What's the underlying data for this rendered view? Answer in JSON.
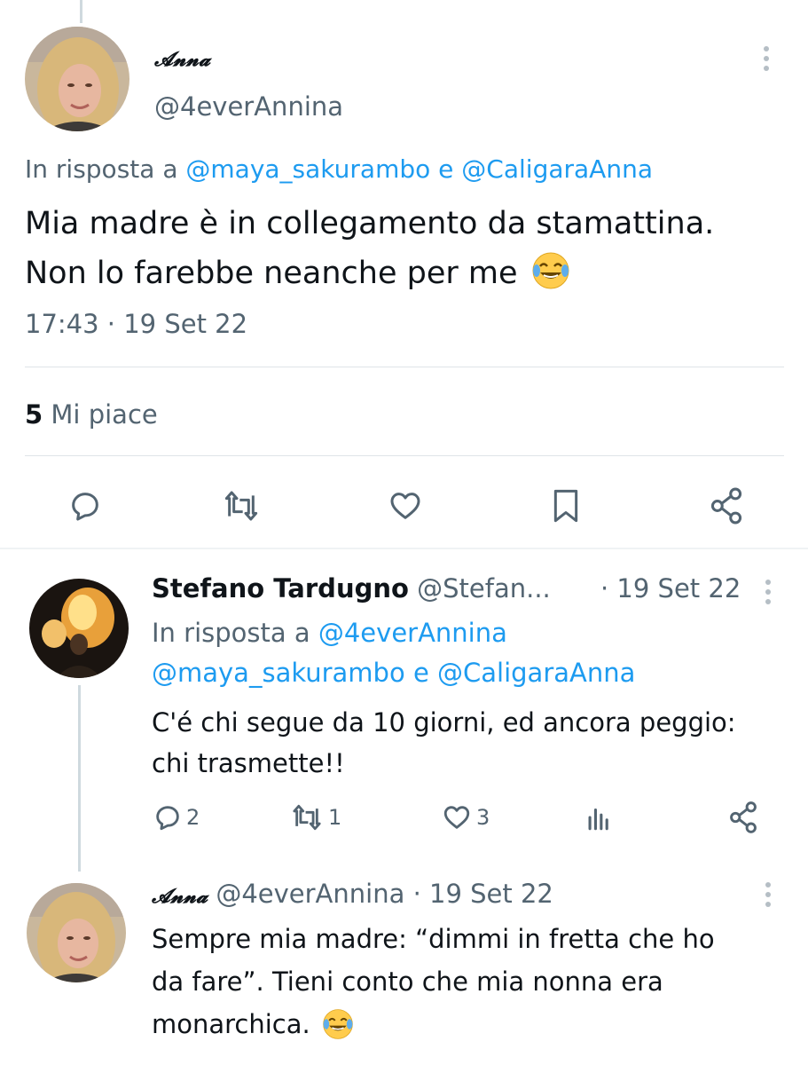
{
  "main_tweet": {
    "display_name": "𝓐𝓷𝓷𝓪",
    "handle": "@4everAnnina",
    "reply_prefix": "In risposta a",
    "reply_user_1": "@maya_sakurambo",
    "reply_conjunction": "e",
    "reply_user_2": "@CaligaraAnna",
    "text_line_1": "Mia madre è in collegamento da stamattina.",
    "text_line_2": "Non lo farebbe neanche per me",
    "emoji": "😂",
    "timestamp": "17:43 · 19 Set 22",
    "likes_count": "5",
    "likes_label": "Mi piace",
    "actions": [
      "reply-icon",
      "retweet-icon",
      "like-icon",
      "bookmark-icon",
      "share-icon"
    ]
  },
  "reply_1": {
    "display_name": "Stefano Tardugno",
    "handle": "@Stefan...",
    "date": "· 19 Set 22",
    "reply_prefix": "In risposta a",
    "reply_user_1": "@4everAnnina",
    "reply_user_2": "@maya_sakurambo",
    "reply_conjunction": "e",
    "reply_user_3": "@CaligaraAnna",
    "text_line_1": "C'é chi segue da 10 giorni, ed ancora peggio:",
    "text_line_2": "chi trasmette!!",
    "replies": "2",
    "retweets": "1",
    "likes": "3"
  },
  "reply_2": {
    "display_name": "𝓐𝓷𝓷𝓪",
    "handle": "@4everAnnina",
    "date": "· 19 Set 22",
    "text_line_1": "Sempre mia madre: “dimmi in fretta che ho",
    "text_line_2": "da fare”. Tieni conto che mia nonna era",
    "text_line_3": "monarchica.",
    "emoji": "😂"
  },
  "colors": {
    "text": "#0f1419",
    "secondary": "#536471",
    "link": "#1d9bf0",
    "divider": "#dfe4e8"
  }
}
